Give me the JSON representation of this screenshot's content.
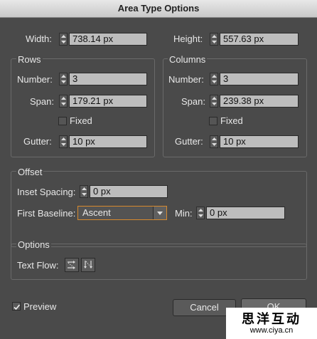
{
  "window": {
    "title": "Area Type Options"
  },
  "size": {
    "width_label": "Width:",
    "width_value": "738.14 px",
    "height_label": "Height:",
    "height_value": "557.63 px"
  },
  "rows": {
    "title": "Rows",
    "number_label": "Number:",
    "number_value": "3",
    "span_label": "Span:",
    "span_value": "179.21 px",
    "fixed_label": "Fixed",
    "gutter_label": "Gutter:",
    "gutter_value": "10 px"
  },
  "columns": {
    "title": "Columns",
    "number_label": "Number:",
    "number_value": "3",
    "span_label": "Span:",
    "span_value": "239.38 px",
    "fixed_label": "Fixed",
    "gutter_label": "Gutter:",
    "gutter_value": "10 px"
  },
  "offset": {
    "title": "Offset",
    "inset_label": "Inset Spacing:",
    "inset_value": "0 px",
    "baseline_label": "First Baseline:",
    "baseline_value": "Ascent",
    "min_label": "Min:",
    "min_value": "0 px"
  },
  "options": {
    "title": "Options",
    "textflow_label": "Text Flow:"
  },
  "footer": {
    "preview_label": "Preview",
    "preview_checked": true,
    "cancel_label": "Cancel",
    "ok_label": "OK"
  },
  "watermark": {
    "line1": "思洋互动",
    "line2": "www.ciya.cn"
  },
  "colors": {
    "accent": "#d78a2e",
    "panel": "#4a4a4a",
    "field": "#bdbdbd"
  }
}
